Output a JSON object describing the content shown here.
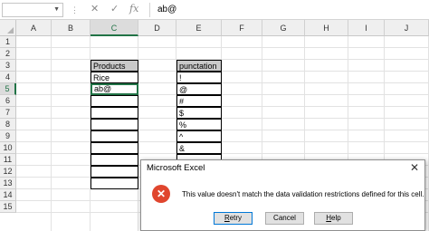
{
  "formula_bar": {
    "name_box": "",
    "separator": "⋮",
    "cancel_icon": "✕",
    "enter_icon": "✓",
    "fx_label": "fx",
    "value": "ab@"
  },
  "columns": [
    "A",
    "B",
    "C",
    "D",
    "E",
    "F",
    "G",
    "H",
    "I",
    "J"
  ],
  "rows": [
    "1",
    "2",
    "3",
    "4",
    "5",
    "6",
    "7",
    "8",
    "9",
    "10",
    "11",
    "12",
    "13",
    "14",
    "15"
  ],
  "selected_column": "C",
  "selected_row": "5",
  "cells": {
    "products_header": "Products",
    "products": [
      "Rice",
      "ab@",
      "",
      "",
      "",
      "",
      "",
      "",
      "",
      ""
    ],
    "punct_header": "punctation",
    "punct": [
      "!",
      "@",
      "#",
      "$",
      "%",
      "^",
      "&",
      "",
      "",
      ""
    ]
  },
  "dialog": {
    "title": "Microsoft Excel",
    "close_glyph": "✕",
    "icon_glyph": "✕",
    "message": "This value doesn't match the data validation restrictions defined for this cell.",
    "retry_u": "R",
    "retry_rest": "etry",
    "cancel": "Cancel",
    "help_u": "H",
    "help_rest": "elp"
  },
  "colors": {
    "accent": "#217346",
    "error": "#e0462e"
  }
}
